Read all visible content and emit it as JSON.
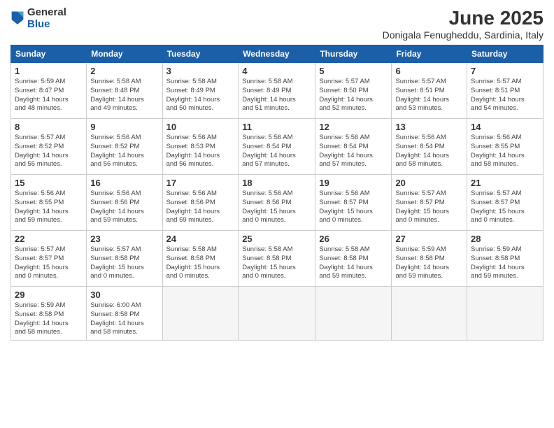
{
  "logo": {
    "general": "General",
    "blue": "Blue"
  },
  "header": {
    "month_year": "June 2025",
    "location": "Donigala Fenugheddu, Sardinia, Italy"
  },
  "weekdays": [
    "Sunday",
    "Monday",
    "Tuesday",
    "Wednesday",
    "Thursday",
    "Friday",
    "Saturday"
  ],
  "weeks": [
    [
      {
        "day": "1",
        "info": "Sunrise: 5:59 AM\nSunset: 8:47 PM\nDaylight: 14 hours\nand 48 minutes."
      },
      {
        "day": "2",
        "info": "Sunrise: 5:58 AM\nSunset: 8:48 PM\nDaylight: 14 hours\nand 49 minutes."
      },
      {
        "day": "3",
        "info": "Sunrise: 5:58 AM\nSunset: 8:49 PM\nDaylight: 14 hours\nand 50 minutes."
      },
      {
        "day": "4",
        "info": "Sunrise: 5:58 AM\nSunset: 8:49 PM\nDaylight: 14 hours\nand 51 minutes."
      },
      {
        "day": "5",
        "info": "Sunrise: 5:57 AM\nSunset: 8:50 PM\nDaylight: 14 hours\nand 52 minutes."
      },
      {
        "day": "6",
        "info": "Sunrise: 5:57 AM\nSunset: 8:51 PM\nDaylight: 14 hours\nand 53 minutes."
      },
      {
        "day": "7",
        "info": "Sunrise: 5:57 AM\nSunset: 8:51 PM\nDaylight: 14 hours\nand 54 minutes."
      }
    ],
    [
      {
        "day": "8",
        "info": "Sunrise: 5:57 AM\nSunset: 8:52 PM\nDaylight: 14 hours\nand 55 minutes."
      },
      {
        "day": "9",
        "info": "Sunrise: 5:56 AM\nSunset: 8:52 PM\nDaylight: 14 hours\nand 56 minutes."
      },
      {
        "day": "10",
        "info": "Sunrise: 5:56 AM\nSunset: 8:53 PM\nDaylight: 14 hours\nand 56 minutes."
      },
      {
        "day": "11",
        "info": "Sunrise: 5:56 AM\nSunset: 8:54 PM\nDaylight: 14 hours\nand 57 minutes."
      },
      {
        "day": "12",
        "info": "Sunrise: 5:56 AM\nSunset: 8:54 PM\nDaylight: 14 hours\nand 57 minutes."
      },
      {
        "day": "13",
        "info": "Sunrise: 5:56 AM\nSunset: 8:54 PM\nDaylight: 14 hours\nand 58 minutes."
      },
      {
        "day": "14",
        "info": "Sunrise: 5:56 AM\nSunset: 8:55 PM\nDaylight: 14 hours\nand 58 minutes."
      }
    ],
    [
      {
        "day": "15",
        "info": "Sunrise: 5:56 AM\nSunset: 8:55 PM\nDaylight: 14 hours\nand 59 minutes."
      },
      {
        "day": "16",
        "info": "Sunrise: 5:56 AM\nSunset: 8:56 PM\nDaylight: 14 hours\nand 59 minutes."
      },
      {
        "day": "17",
        "info": "Sunrise: 5:56 AM\nSunset: 8:56 PM\nDaylight: 14 hours\nand 59 minutes."
      },
      {
        "day": "18",
        "info": "Sunrise: 5:56 AM\nSunset: 8:56 PM\nDaylight: 15 hours\nand 0 minutes."
      },
      {
        "day": "19",
        "info": "Sunrise: 5:56 AM\nSunset: 8:57 PM\nDaylight: 15 hours\nand 0 minutes."
      },
      {
        "day": "20",
        "info": "Sunrise: 5:57 AM\nSunset: 8:57 PM\nDaylight: 15 hours\nand 0 minutes."
      },
      {
        "day": "21",
        "info": "Sunrise: 5:57 AM\nSunset: 8:57 PM\nDaylight: 15 hours\nand 0 minutes."
      }
    ],
    [
      {
        "day": "22",
        "info": "Sunrise: 5:57 AM\nSunset: 8:57 PM\nDaylight: 15 hours\nand 0 minutes."
      },
      {
        "day": "23",
        "info": "Sunrise: 5:57 AM\nSunset: 8:58 PM\nDaylight: 15 hours\nand 0 minutes."
      },
      {
        "day": "24",
        "info": "Sunrise: 5:58 AM\nSunset: 8:58 PM\nDaylight: 15 hours\nand 0 minutes."
      },
      {
        "day": "25",
        "info": "Sunrise: 5:58 AM\nSunset: 8:58 PM\nDaylight: 15 hours\nand 0 minutes."
      },
      {
        "day": "26",
        "info": "Sunrise: 5:58 AM\nSunset: 8:58 PM\nDaylight: 14 hours\nand 59 minutes."
      },
      {
        "day": "27",
        "info": "Sunrise: 5:59 AM\nSunset: 8:58 PM\nDaylight: 14 hours\nand 59 minutes."
      },
      {
        "day": "28",
        "info": "Sunrise: 5:59 AM\nSunset: 8:58 PM\nDaylight: 14 hours\nand 59 minutes."
      }
    ],
    [
      {
        "day": "29",
        "info": "Sunrise: 5:59 AM\nSunset: 8:58 PM\nDaylight: 14 hours\nand 58 minutes."
      },
      {
        "day": "30",
        "info": "Sunrise: 6:00 AM\nSunset: 8:58 PM\nDaylight: 14 hours\nand 58 minutes."
      },
      null,
      null,
      null,
      null,
      null
    ]
  ]
}
